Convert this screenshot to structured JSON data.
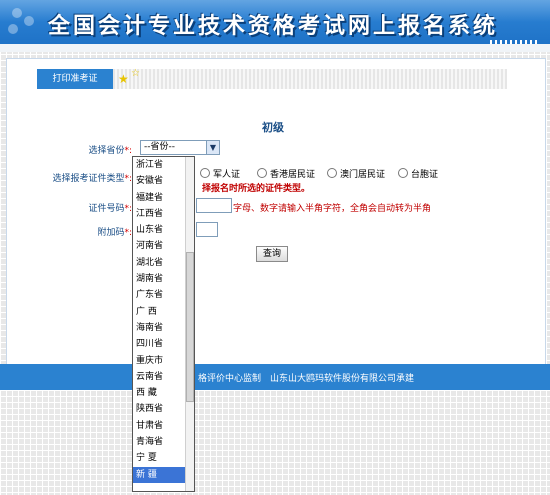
{
  "header": {
    "title": "全国会计专业技术资格考试网上报名系统"
  },
  "tabs": {
    "print_label": "打印准考证"
  },
  "form": {
    "level": "初级",
    "province_label": "选择省份",
    "cert_type_label": "选择报考证件类型",
    "cert_number_label": "证件号码",
    "extra_code_label": "附加码",
    "required_mark": "*:",
    "province_selected": "--省份--",
    "cert_options": [
      "军人证",
      "香港居民证",
      "澳门居民证",
      "台胞证"
    ],
    "cert_warning": "择报名时所选的证件类型。",
    "cert_hint": "字母、数字请输入半角字符，全角会自动转为半角",
    "query_button": "查询"
  },
  "province_list": [
    "浙江省",
    "安徽省",
    "福建省",
    "江西省",
    "山东省",
    "河南省",
    "湖北省",
    "湖南省",
    "广东省",
    "广 西",
    "海南省",
    "四川省",
    "重庆市",
    "云南省",
    "西 藏",
    "陕西省",
    "甘肃省",
    "青海省",
    "宁 夏",
    "新 疆"
  ],
  "province_list_selected_index": 19,
  "footer": {
    "left_text": "格评价中心监制",
    "right_text": "山东山大鸥玛软件股份有限公司承建"
  },
  "colors": {
    "accent": "#2b82d0",
    "label": "#1a4e86",
    "warning": "#c00000",
    "selected": "#3b74d6"
  }
}
